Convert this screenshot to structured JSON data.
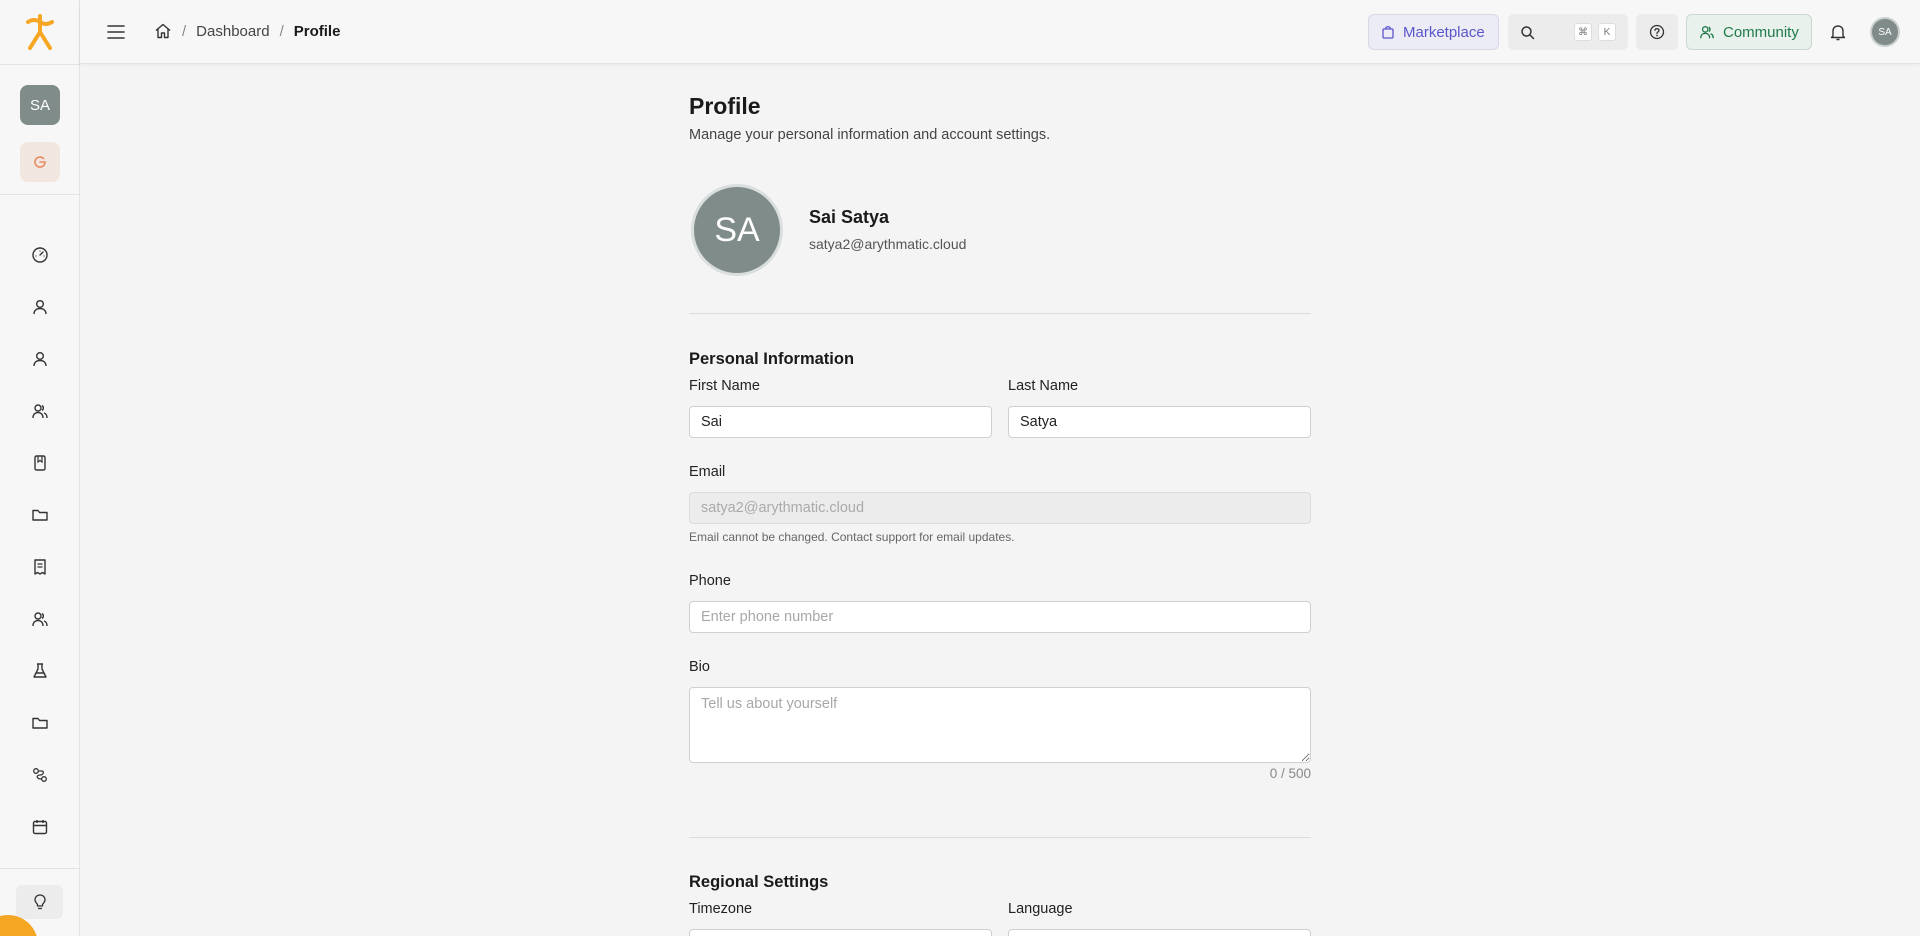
{
  "sidebar": {
    "avatar_initials": "SA",
    "nav_icons": [
      "dashboard-icon",
      "user-icon",
      "user-icon-2",
      "users-icon",
      "book-icon",
      "folder-icon",
      "receipt-icon",
      "users-icon-2",
      "flask-icon",
      "folder-icon-2",
      "route-icon",
      "calendar-icon"
    ],
    "bottom_icon": "lightbulb-icon"
  },
  "header": {
    "breadcrumb": {
      "home_icon": "home-icon",
      "items": [
        "Dashboard",
        "Profile"
      ],
      "separator": "/"
    },
    "marketplace_label": "Marketplace",
    "search_shortcut": [
      "⌘",
      "K"
    ],
    "community_label": "Community",
    "avatar_initials": "SA"
  },
  "main": {
    "title": "Profile",
    "subtitle": "Manage your personal information and account settings.",
    "user": {
      "initials": "SA",
      "name": "Sai Satya",
      "email": "satya2@arythmatic.cloud"
    },
    "personal": {
      "section_title": "Personal Information",
      "first_name_label": "First Name",
      "first_name_value": "Sai",
      "last_name_label": "Last Name",
      "last_name_value": "Satya",
      "email_label": "Email",
      "email_value": "satya2@arythmatic.cloud",
      "email_helper": "Email cannot be changed. Contact support for email updates.",
      "phone_label": "Phone",
      "phone_placeholder": "Enter phone number",
      "bio_label": "Bio",
      "bio_placeholder": "Tell us about yourself",
      "bio_counter": "0 / 500"
    },
    "regional": {
      "section_title": "Regional Settings",
      "timezone_label": "Timezone",
      "language_label": "Language"
    }
  },
  "colors": {
    "brand_orange": "#f5a623",
    "avatar_gray": "#7f8c8a",
    "marketplace_purple": "#5b56c9",
    "community_green": "#1f7a4a"
  }
}
